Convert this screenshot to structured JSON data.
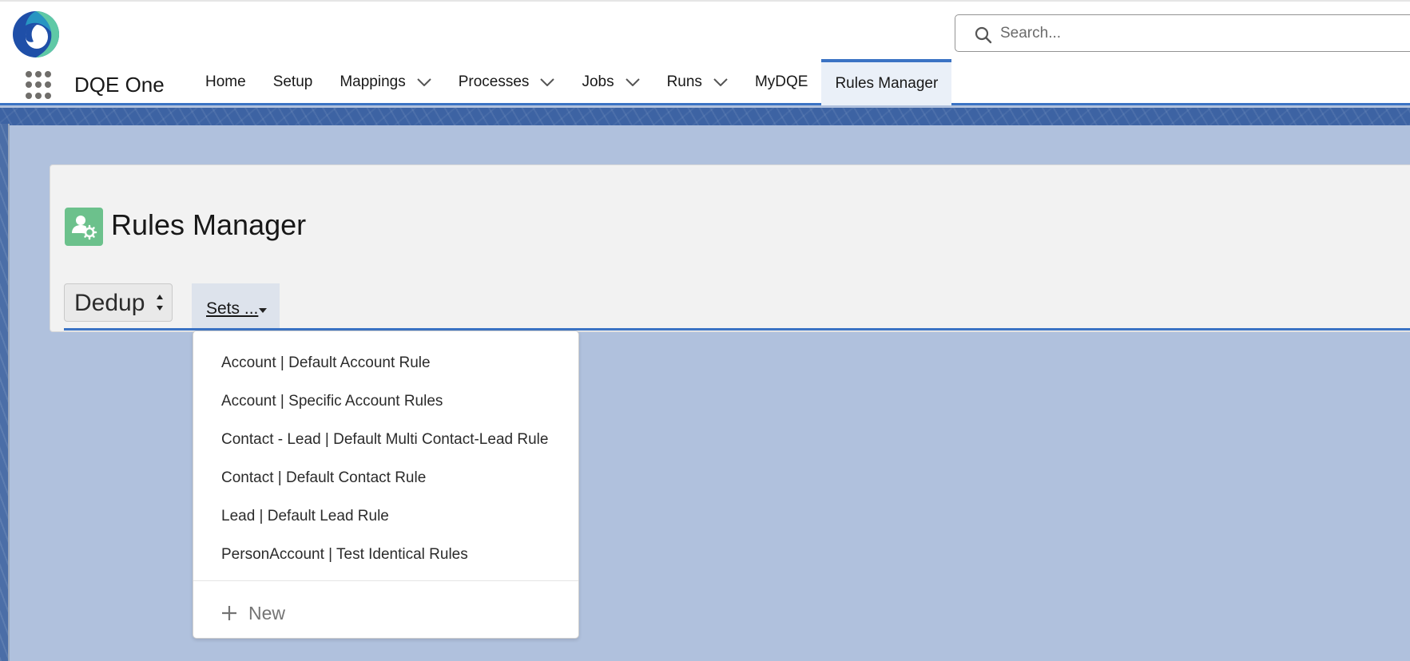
{
  "search": {
    "placeholder": "Search..."
  },
  "app": {
    "name": "DQE One"
  },
  "nav": {
    "items": [
      {
        "label": "Home",
        "dropdown": false
      },
      {
        "label": "Setup",
        "dropdown": false
      },
      {
        "label": "Mappings",
        "dropdown": true
      },
      {
        "label": "Processes",
        "dropdown": true
      },
      {
        "label": "Jobs",
        "dropdown": true
      },
      {
        "label": "Runs",
        "dropdown": true
      },
      {
        "label": "MyDQE",
        "dropdown": false
      },
      {
        "label": "Rules Manager",
        "dropdown": false,
        "active": true
      }
    ]
  },
  "page": {
    "title": "Rules Manager",
    "icon": "user-gear-icon"
  },
  "controls": {
    "dedup_select": "Dedup",
    "sets_tab": "Sets ..."
  },
  "dropdown": {
    "items": [
      "Account | Default Account Rule",
      "Account | Specific Account Rules",
      "Contact - Lead | Default Multi Contact-Lead Rule",
      "Contact | Default Contact Rule",
      "Lead | Default Lead Rule",
      "PersonAccount | Test Identical Rules"
    ],
    "new_label": "New"
  },
  "colors": {
    "accent": "#3b73c4",
    "icon_green": "#6cc18c",
    "background": "#b0c1dd"
  }
}
